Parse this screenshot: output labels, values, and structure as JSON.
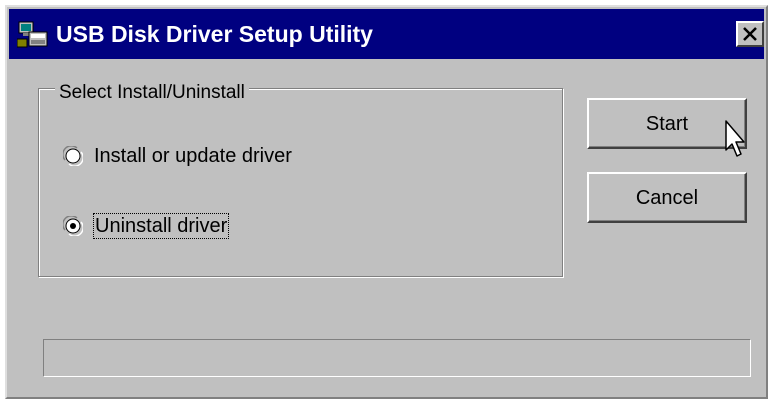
{
  "window": {
    "title": "USB Disk Driver Setup Utility",
    "icon": "usb-drive-icon",
    "close_glyph": "close-icon"
  },
  "group": {
    "label": "Select Install/Uninstall",
    "options": [
      {
        "label": "Install or update driver",
        "selected": false
      },
      {
        "label": "Uninstall driver",
        "selected": true
      }
    ]
  },
  "buttons": {
    "start_label": "Start",
    "cancel_label": "Cancel"
  },
  "progress": {
    "value_percent": 0
  },
  "colors": {
    "titlebar": "#000080",
    "face": "#c0c0c0",
    "title_text": "#ffffff"
  }
}
